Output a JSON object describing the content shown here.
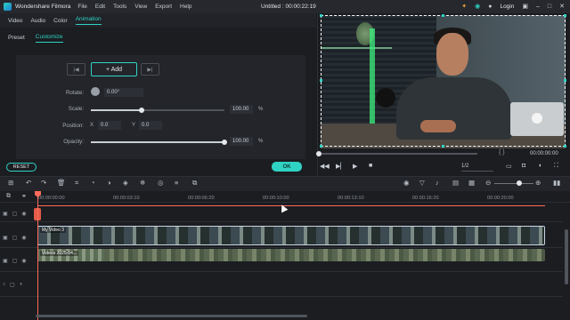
{
  "app": {
    "name": "Wondershare Filmora",
    "menu": [
      "File",
      "Edit",
      "Tools",
      "View",
      "Export",
      "Help"
    ],
    "document_title": "Untitled : 00:00:22:19",
    "login_label": "Login"
  },
  "panel": {
    "tabs": [
      "Video",
      "Audio",
      "Color",
      "Animation"
    ],
    "active_tab": "Animation",
    "subtabs": [
      "Preset",
      "Customize"
    ],
    "active_subtab": "Customize",
    "add_label": "+ Add",
    "rotate": {
      "label": "Rotate:",
      "value": "0.00°"
    },
    "scale": {
      "label": "Scale:",
      "value": "100.00",
      "unit": "%",
      "level": 0.38
    },
    "position": {
      "label": "Position:",
      "x_label": "X",
      "x_value": "0.0",
      "y_label": "Y",
      "y_value": "0.0"
    },
    "opacity": {
      "label": "Opacity:",
      "value": "100.00",
      "unit": "%",
      "level": 1.0
    },
    "reset_label": "RESET",
    "ok_label": "OK"
  },
  "preview": {
    "timecode": "00:00:00:00",
    "ratio": "1/2",
    "brackets": "{   }"
  },
  "timeline": {
    "ruler": [
      "00:00:00:00",
      "00:00:03:10",
      "00:00:06:20",
      "00:00:10:00",
      "00:00:13:10",
      "00:00:16:20",
      "00:00:20:00"
    ],
    "clips": {
      "video1": "My Video 3",
      "video2": "Videos 2025-04..."
    }
  }
}
